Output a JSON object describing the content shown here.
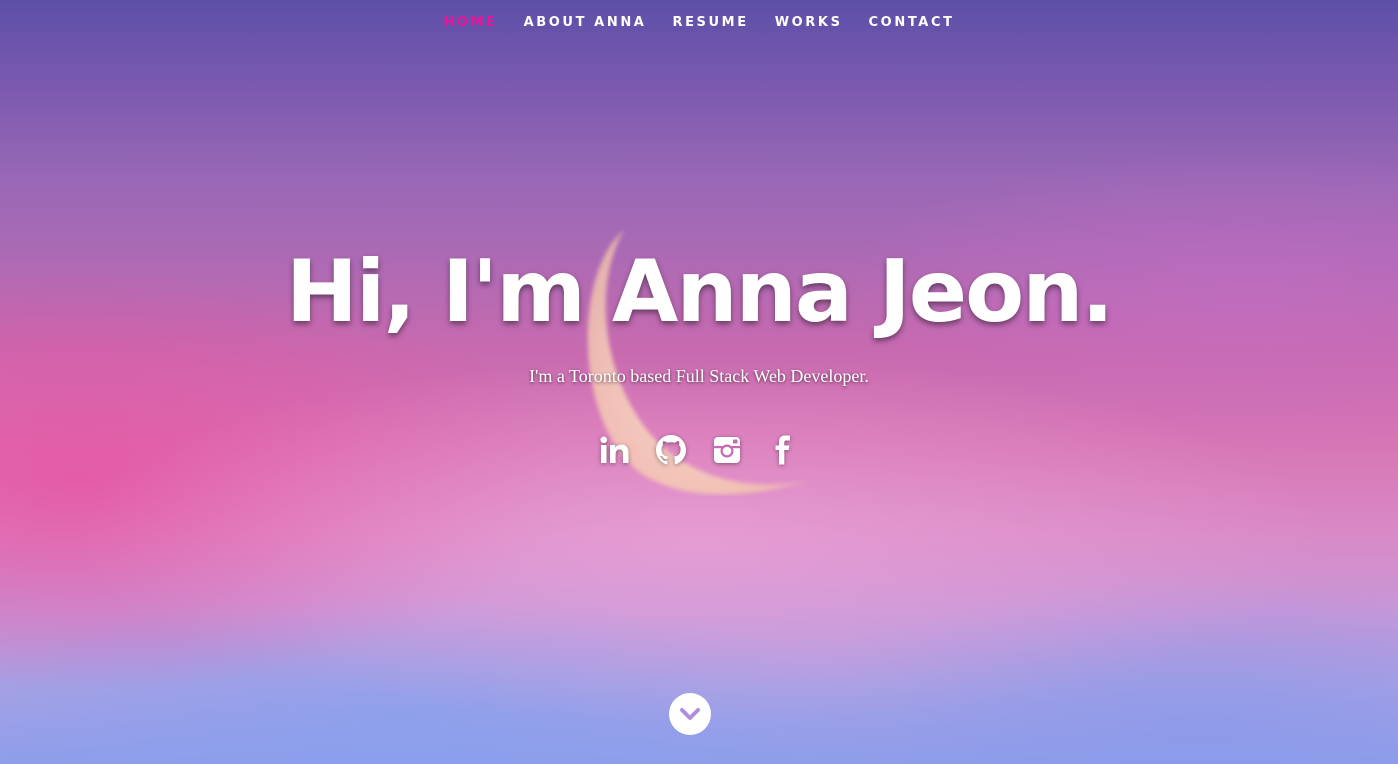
{
  "nav": {
    "items": [
      {
        "label": "HOME",
        "active": true
      },
      {
        "label": "ABOUT ANNA",
        "active": false
      },
      {
        "label": "RESUME",
        "active": false
      },
      {
        "label": "WORKS",
        "active": false
      },
      {
        "label": "CONTACT",
        "active": false
      }
    ],
    "active_color": "#e8149a"
  },
  "hero": {
    "title": "Hi, I'm Anna Jeon.",
    "subtitle": "I'm a Toronto based Full Stack Web Developer."
  },
  "social": [
    {
      "name": "linkedin-icon"
    },
    {
      "name": "github-icon"
    },
    {
      "name": "instagram-icon"
    },
    {
      "name": "facebook-icon"
    }
  ],
  "scroll_down": {
    "icon": "chevron-down-icon",
    "color": "#ad8fe0"
  }
}
